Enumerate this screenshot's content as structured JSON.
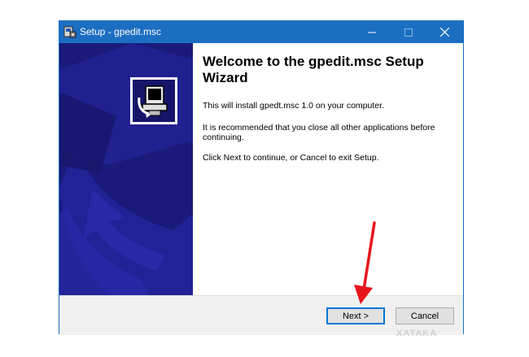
{
  "window": {
    "title": "Setup - gpedit.msc",
    "title_icon": "setup-installer-icon",
    "controls": {
      "minimize": "minimize-icon",
      "maximize": "maximize-icon",
      "close": "close-icon"
    }
  },
  "wizard": {
    "heading": "Welcome to the gpedit.msc Setup Wizard",
    "paragraphs": [
      "This will install gpedt.msc 1.0 on your computer.",
      "It is recommended that you close all other applications before continuing.",
      "Click Next to continue, or Cancel to exit Setup."
    ],
    "logo_icon": "computer-install-icon"
  },
  "buttons": {
    "next": "Next >",
    "cancel": "Cancel"
  },
  "annotation": {
    "arrow_color": "#e8141c",
    "arrow_icon": "red-arrow-pointer"
  },
  "watermark": "XATAKA",
  "colors": {
    "titlebar": "#1b6ec2",
    "side_panel": "#1a1a7a"
  }
}
